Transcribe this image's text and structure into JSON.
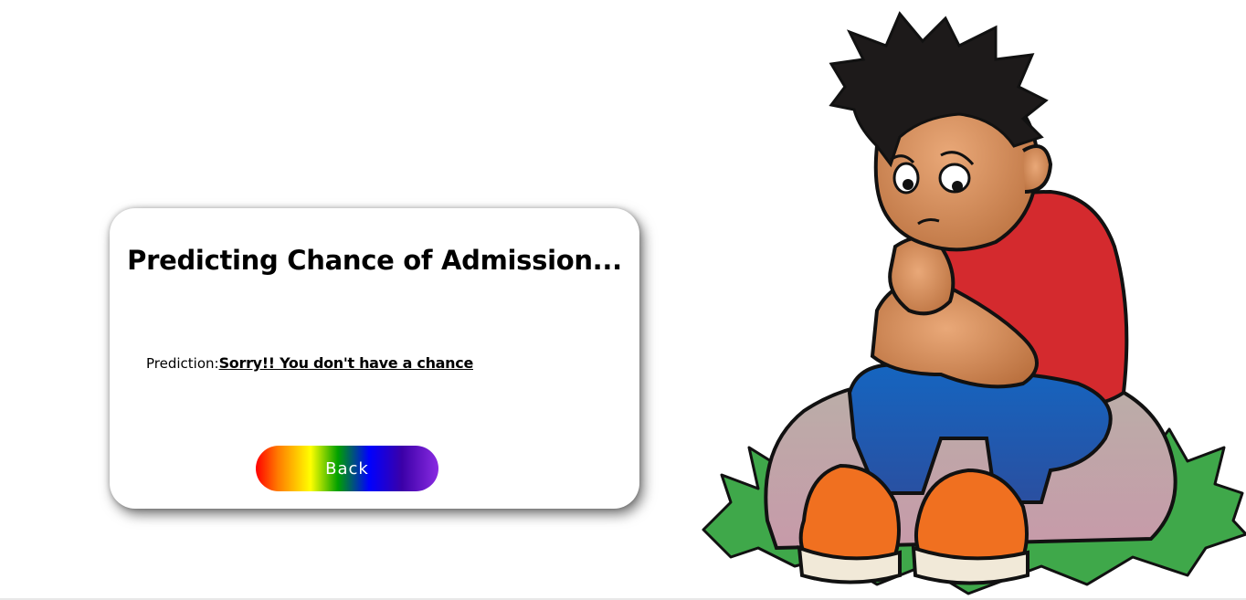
{
  "card": {
    "title": "Predicting Chance of Admission...",
    "prediction_label": "Prediction:",
    "prediction_result": "Sorry!! You don't have a chance",
    "back_label": "Back"
  },
  "illustration": {
    "icon": "sad-boy-sitting-on-rock-illustration"
  },
  "colors": {
    "shirt": "#d42a2e",
    "pants": "#1560b0",
    "grass": "#3fa34a",
    "shoes": "#f07020",
    "rock": "#c4a8ae",
    "skin": "#cf8a55"
  }
}
